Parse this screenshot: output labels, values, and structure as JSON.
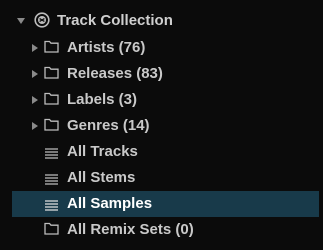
{
  "track_collection": {
    "label": "Track Collection",
    "expanded": true,
    "icon": "collection-icon",
    "items": [
      {
        "label": "Artists (76)",
        "icon": "folder-icon",
        "expandable": true
      },
      {
        "label": "Releases (83)",
        "icon": "folder-icon",
        "expandable": true
      },
      {
        "label": "Labels (3)",
        "icon": "folder-icon",
        "expandable": true
      },
      {
        "label": "Genres (14)",
        "icon": "folder-icon",
        "expandable": true
      },
      {
        "label": "All Tracks",
        "icon": "list-icon",
        "expandable": false
      },
      {
        "label": "All Stems",
        "icon": "list-icon",
        "expandable": false
      },
      {
        "label": "All Samples",
        "icon": "list-icon",
        "expandable": false,
        "selected": true
      },
      {
        "label": "All Remix Sets (0)",
        "icon": "folder-icon",
        "expandable": false
      }
    ]
  },
  "colors": {
    "background": "#0b0b0b",
    "selection": "#183a4a",
    "text": "#c9c9c9",
    "icon": "#8a8a8a"
  }
}
